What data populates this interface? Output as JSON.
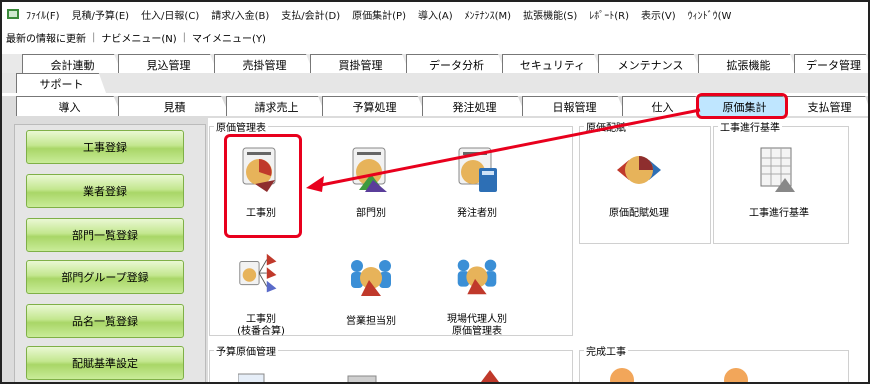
{
  "menu": [
    "ﾌｧｲﾙ(F)",
    "見積/予算(E)",
    "仕入/日報(C)",
    "請求/入金(B)",
    "支払/会計(D)",
    "原価集計(P)",
    "導入(A)",
    "ﾒﾝﾃﾅﾝｽ(M)",
    "拡張機能(S)",
    "ﾚﾎﾟｰﾄ(R)",
    "表示(V)",
    "ｳｨﾝﾄﾞｳ(W"
  ],
  "subbar": [
    "最新の情報に更新",
    "ナビメニュー(N)",
    "マイメニュー(Y)"
  ],
  "tabs_row1": [
    "会計連動",
    "見込管理",
    "売掛管理",
    "買掛管理",
    "データ分析",
    "セキュリティ",
    "メンテナンス",
    "拡張機能",
    "データ管理"
  ],
  "tabs_row2": [
    "サポート"
  ],
  "tabs_row3": [
    "導入",
    "見積",
    "請求売上",
    "予算処理",
    "発注処理",
    "日報管理",
    "仕入",
    "原価集計",
    "支払管理"
  ],
  "left_buttons": [
    "工事登録",
    "業者登録",
    "部門一覧登録",
    "部門グループ登録",
    "品名一覧登録",
    "配賦基準設定"
  ],
  "groups": {
    "genka": {
      "title": "原価管理表",
      "tiles": [
        "工事別",
        "部門別",
        "発注者別",
        "工事別\n(枝番合算)",
        "営業担当別",
        "現場代理人別\n原価管理表"
      ]
    },
    "haifu": {
      "title": "原価配賦",
      "tiles": [
        "原価配賦処理"
      ]
    },
    "kijun": {
      "title": "工事進行基準",
      "tiles": [
        "工事進行基準"
      ]
    },
    "yosan": {
      "title": "予算原価管理"
    },
    "kansei": {
      "title": "完成工事"
    }
  },
  "colors": {
    "highlight": "#e8001d",
    "active_tab": "#bfe6ff",
    "button_green": "#a9d667"
  }
}
